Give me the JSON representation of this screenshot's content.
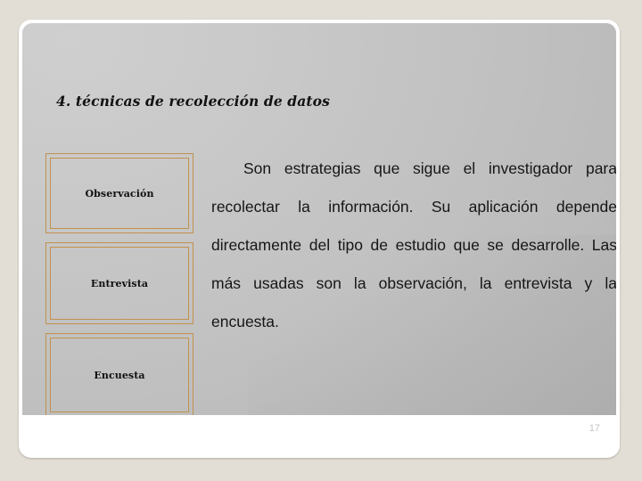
{
  "slide": {
    "title": "4. técnicas de recolección de datos",
    "page_number": "17",
    "boxes": [
      {
        "label": "Observación"
      },
      {
        "label": "Entrevista"
      },
      {
        "label": "Encuesta"
      }
    ],
    "body_text": "Son estrategias que sigue el investigador para recolectar la información. Su aplicación depende directamente del tipo de estudio que se desarrolle. Las más usadas son la observación, la entrevista y la encuesta."
  },
  "colors": {
    "outer_background": "#e2ded5",
    "slide_border": "#ffffff",
    "content_gradient_light": "#cfcfcf",
    "content_gradient_dark": "#b4b4b4",
    "box_border": "#c2914d",
    "title_text": "#121212",
    "body_text": "#161616",
    "page_number_text": "#c3c3c3"
  }
}
